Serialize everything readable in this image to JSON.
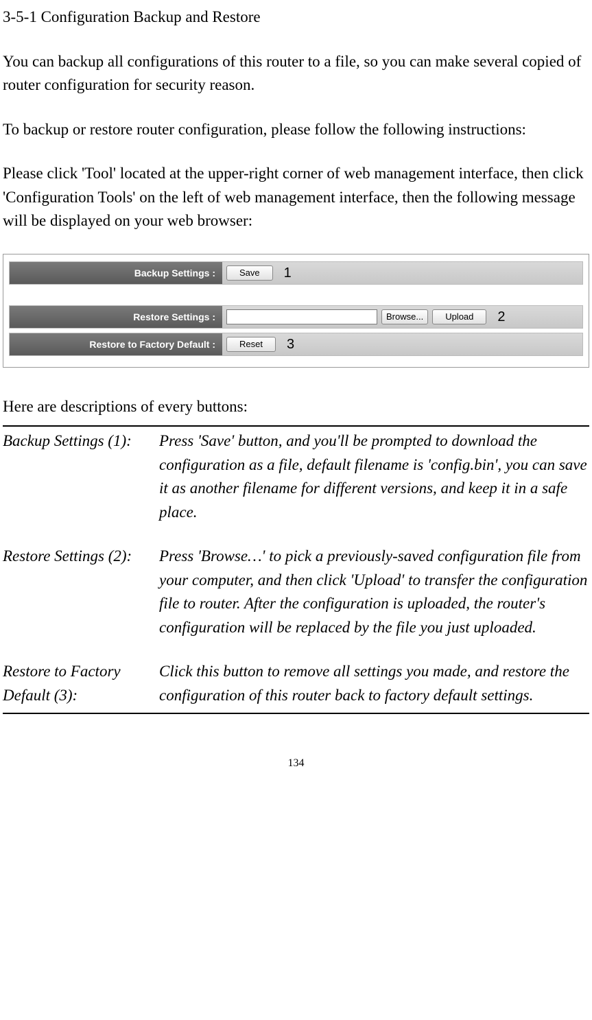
{
  "title": "3-5-1 Configuration Backup and Restore",
  "intro1": "You can backup all configurations of this router to a file, so you can make several copied of router configuration for security reason.",
  "intro2": "To backup or restore router configuration, please follow the following instructions:",
  "intro3": "Please click 'Tool' located at the upper-right corner of web management interface, then click 'Configuration Tools' on the left of web management interface, then the following message will be displayed on your web browser:",
  "ui": {
    "backup_label": "Backup Settings :",
    "restore_label": "Restore Settings :",
    "factory_label": "Restore to Factory Default :",
    "save_btn": "Save",
    "browse_btn": "Browse...",
    "upload_btn": "Upload",
    "reset_btn": "Reset",
    "callout1": "1",
    "callout2": "2",
    "callout3": "3",
    "file_value": ""
  },
  "desc_intro": "Here are descriptions of every buttons:",
  "items": [
    {
      "term": "Backup Settings (1):",
      "def": "Press 'Save' button, and you'll be prompted to download the configuration as a file, default filename is 'config.bin', you can save it as another filename for different versions, and keep it in a safe place."
    },
    {
      "term": "Restore Settings (2):",
      "def": "Press 'Browse…' to pick a previously-saved configuration file from your computer, and then click 'Upload' to transfer the configuration file to router. After the configuration is uploaded, the router's configuration will be replaced by the file you just uploaded."
    },
    {
      "term": "Restore to Factory Default (3):",
      "def": "Click this button to remove all settings you made, and restore the configuration of this router back to factory default settings."
    }
  ],
  "page_number": "134"
}
